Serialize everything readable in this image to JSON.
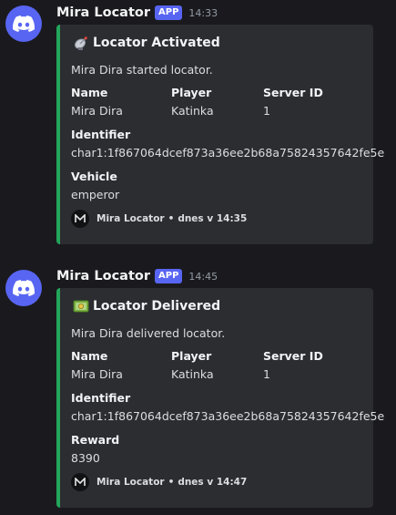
{
  "messages": [
    {
      "author": "Mira Locator",
      "badge": "APP",
      "time": "14:33",
      "embed": {
        "title": "Locator Activated",
        "title_emoji": "satellite-dish-icon",
        "description": "Mira Dira started locator.",
        "fields": [
          {
            "name": "Name",
            "value": "Mira Dira"
          },
          {
            "name": "Player",
            "value": "Katinka"
          },
          {
            "name": "Server ID",
            "value": "1"
          },
          {
            "name": "Identifier",
            "value": "char1:1f867064dcef873a36ee2b68a75824357642fe5e"
          },
          {
            "name": "Vehicle",
            "value": "emperor"
          }
        ],
        "footer_name": "Mira Locator",
        "footer_separator": "•",
        "footer_time": "dnes v 14:35",
        "accent": "#23a55a"
      }
    },
    {
      "author": "Mira Locator",
      "badge": "APP",
      "time": "14:45",
      "embed": {
        "title": "Locator Delivered",
        "title_emoji": "money-banknote-icon",
        "description": "Mira Dira delivered locator.",
        "fields": [
          {
            "name": "Name",
            "value": "Mira Dira"
          },
          {
            "name": "Player",
            "value": "Katinka"
          },
          {
            "name": "Server ID",
            "value": "1"
          },
          {
            "name": "Identifier",
            "value": "char1:1f867064dcef873a36ee2b68a75824357642fe5e"
          },
          {
            "name": "Reward",
            "value": "8390"
          }
        ],
        "footer_name": "Mira Locator",
        "footer_separator": "•",
        "footer_time": "dnes v 14:47",
        "accent": "#23a55a"
      }
    }
  ],
  "colors": {
    "background": "#1a1a1e",
    "embed_background": "#2b2d31",
    "brand": "#5865f2"
  }
}
